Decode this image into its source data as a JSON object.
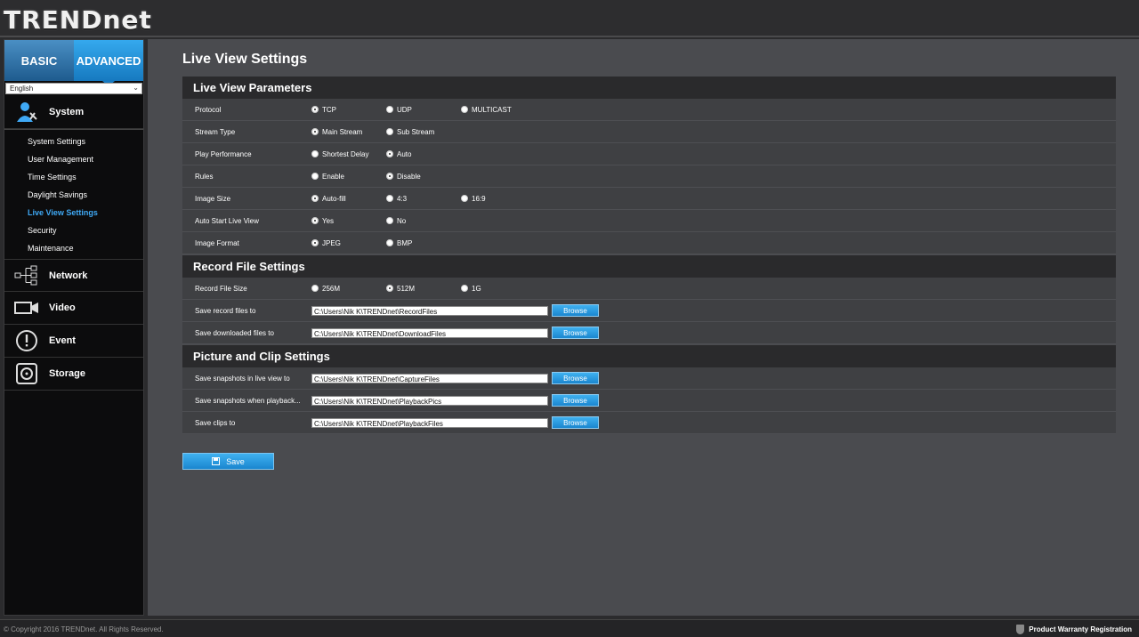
{
  "brand": {
    "logo_text": "TRENDnet"
  },
  "sidebar": {
    "tabs": {
      "basic": "BASIC",
      "advanced": "ADVANCED"
    },
    "language": "English",
    "system": "System",
    "system_items": [
      "System Settings",
      "User Management",
      "Time Settings",
      "Daylight Savings",
      "Live View Settings",
      "Security",
      "Maintenance"
    ],
    "network": "Network",
    "video": "Video",
    "event": "Event",
    "storage": "Storage"
  },
  "page": {
    "title": "Live View Settings",
    "sections": {
      "live": "Live View Parameters",
      "record": "Record File Settings",
      "picture": "Picture and Clip Settings"
    },
    "live_rows": {
      "protocol": {
        "label": "Protocol",
        "opts": [
          "TCP",
          "UDP",
          "MULTICAST"
        ],
        "selected": "TCP"
      },
      "stream": {
        "label": "Stream Type",
        "opts": [
          "Main Stream",
          "Sub Stream"
        ],
        "selected": "Main Stream"
      },
      "perf": {
        "label": "Play Performance",
        "opts": [
          "Shortest Delay",
          "Auto"
        ],
        "selected": "Auto"
      },
      "rules": {
        "label": "Rules",
        "opts": [
          "Enable",
          "Disable"
        ],
        "selected": "Disable"
      },
      "size": {
        "label": "Image Size",
        "opts": [
          "Auto-fill",
          "4:3",
          "16:9"
        ],
        "selected": "Auto-fill"
      },
      "autostart": {
        "label": "Auto Start Live View",
        "opts": [
          "Yes",
          "No"
        ],
        "selected": "Yes"
      },
      "format": {
        "label": "Image Format",
        "opts": [
          "JPEG",
          "BMP"
        ],
        "selected": "JPEG"
      }
    },
    "record_rows": {
      "filesize": {
        "label": "Record File Size",
        "opts": [
          "256M",
          "512M",
          "1G"
        ],
        "selected": "512M"
      },
      "save_record": {
        "label": "Save record files to",
        "path": "C:\\Users\\Nik K\\TRENDnet\\RecordFiles"
      },
      "save_download": {
        "label": "Save downloaded files to",
        "path": "C:\\Users\\Nik K\\TRENDnet\\DownloadFiles"
      }
    },
    "picture_rows": {
      "snap_live": {
        "label": "Save snapshots in live view to",
        "path": "C:\\Users\\Nik K\\TRENDnet\\CaptureFiles"
      },
      "snap_play": {
        "label": "Save snapshots when playback...",
        "path": "C:\\Users\\Nik K\\TRENDnet\\PlaybackPics"
      },
      "clips": {
        "label": "Save clips to",
        "path": "C:\\Users\\Nik K\\TRENDnet\\PlaybackFiles"
      }
    },
    "browse_label": "Browse",
    "save_label": "Save"
  },
  "footer": {
    "copyright": "© Copyright 2016 TRENDnet. All Rights Reserved.",
    "warranty": "Product Warranty Registration"
  },
  "colors": {
    "accent": "#1a86cf",
    "active_nav": "#3fa9f5"
  }
}
